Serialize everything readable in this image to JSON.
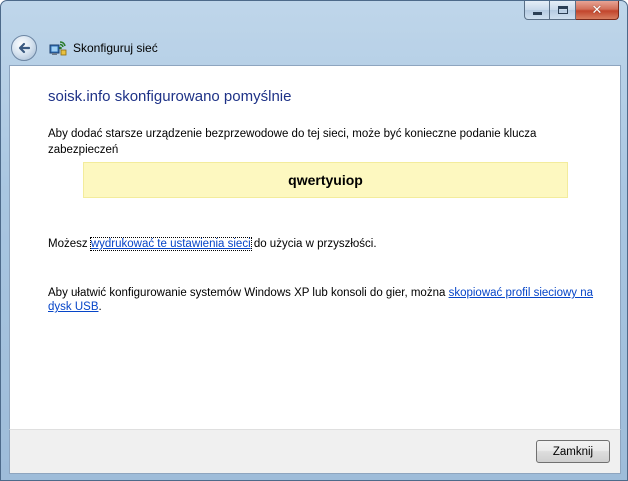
{
  "window": {
    "title": "Skonfiguruj sieć",
    "caption_buttons": {
      "minimize": "minimize-icon",
      "maximize": "maximize-icon",
      "close": "close-icon"
    }
  },
  "navigation": {
    "back_icon": "back-arrow-icon",
    "app_icon": "network-setup-icon"
  },
  "content": {
    "heading": "soisk.info skonfigurowano pomyślnie",
    "intro": "Aby dodać starsze urządzenie bezprzewodowe do tej sieci, może być konieczne podanie klucza zabezpieczeń",
    "security_key": "qwertyuiop",
    "print": {
      "prefix": "Możesz ",
      "link": "wydrukować te ustawienia sieci",
      "suffix": " do użycia w przyszłości."
    },
    "usb": {
      "prefix": "Aby ułatwić konfigurowanie systemów Windows XP lub konsoli do gier, można ",
      "link": "skopiować profil sieciowy na dysk USB",
      "suffix": "."
    }
  },
  "footer": {
    "close_label": "Zamknij"
  },
  "colors": {
    "heading": "#1e3287",
    "link": "#0645c8",
    "key_background": "#fdf8c0",
    "frame": "#a9c6e1"
  }
}
